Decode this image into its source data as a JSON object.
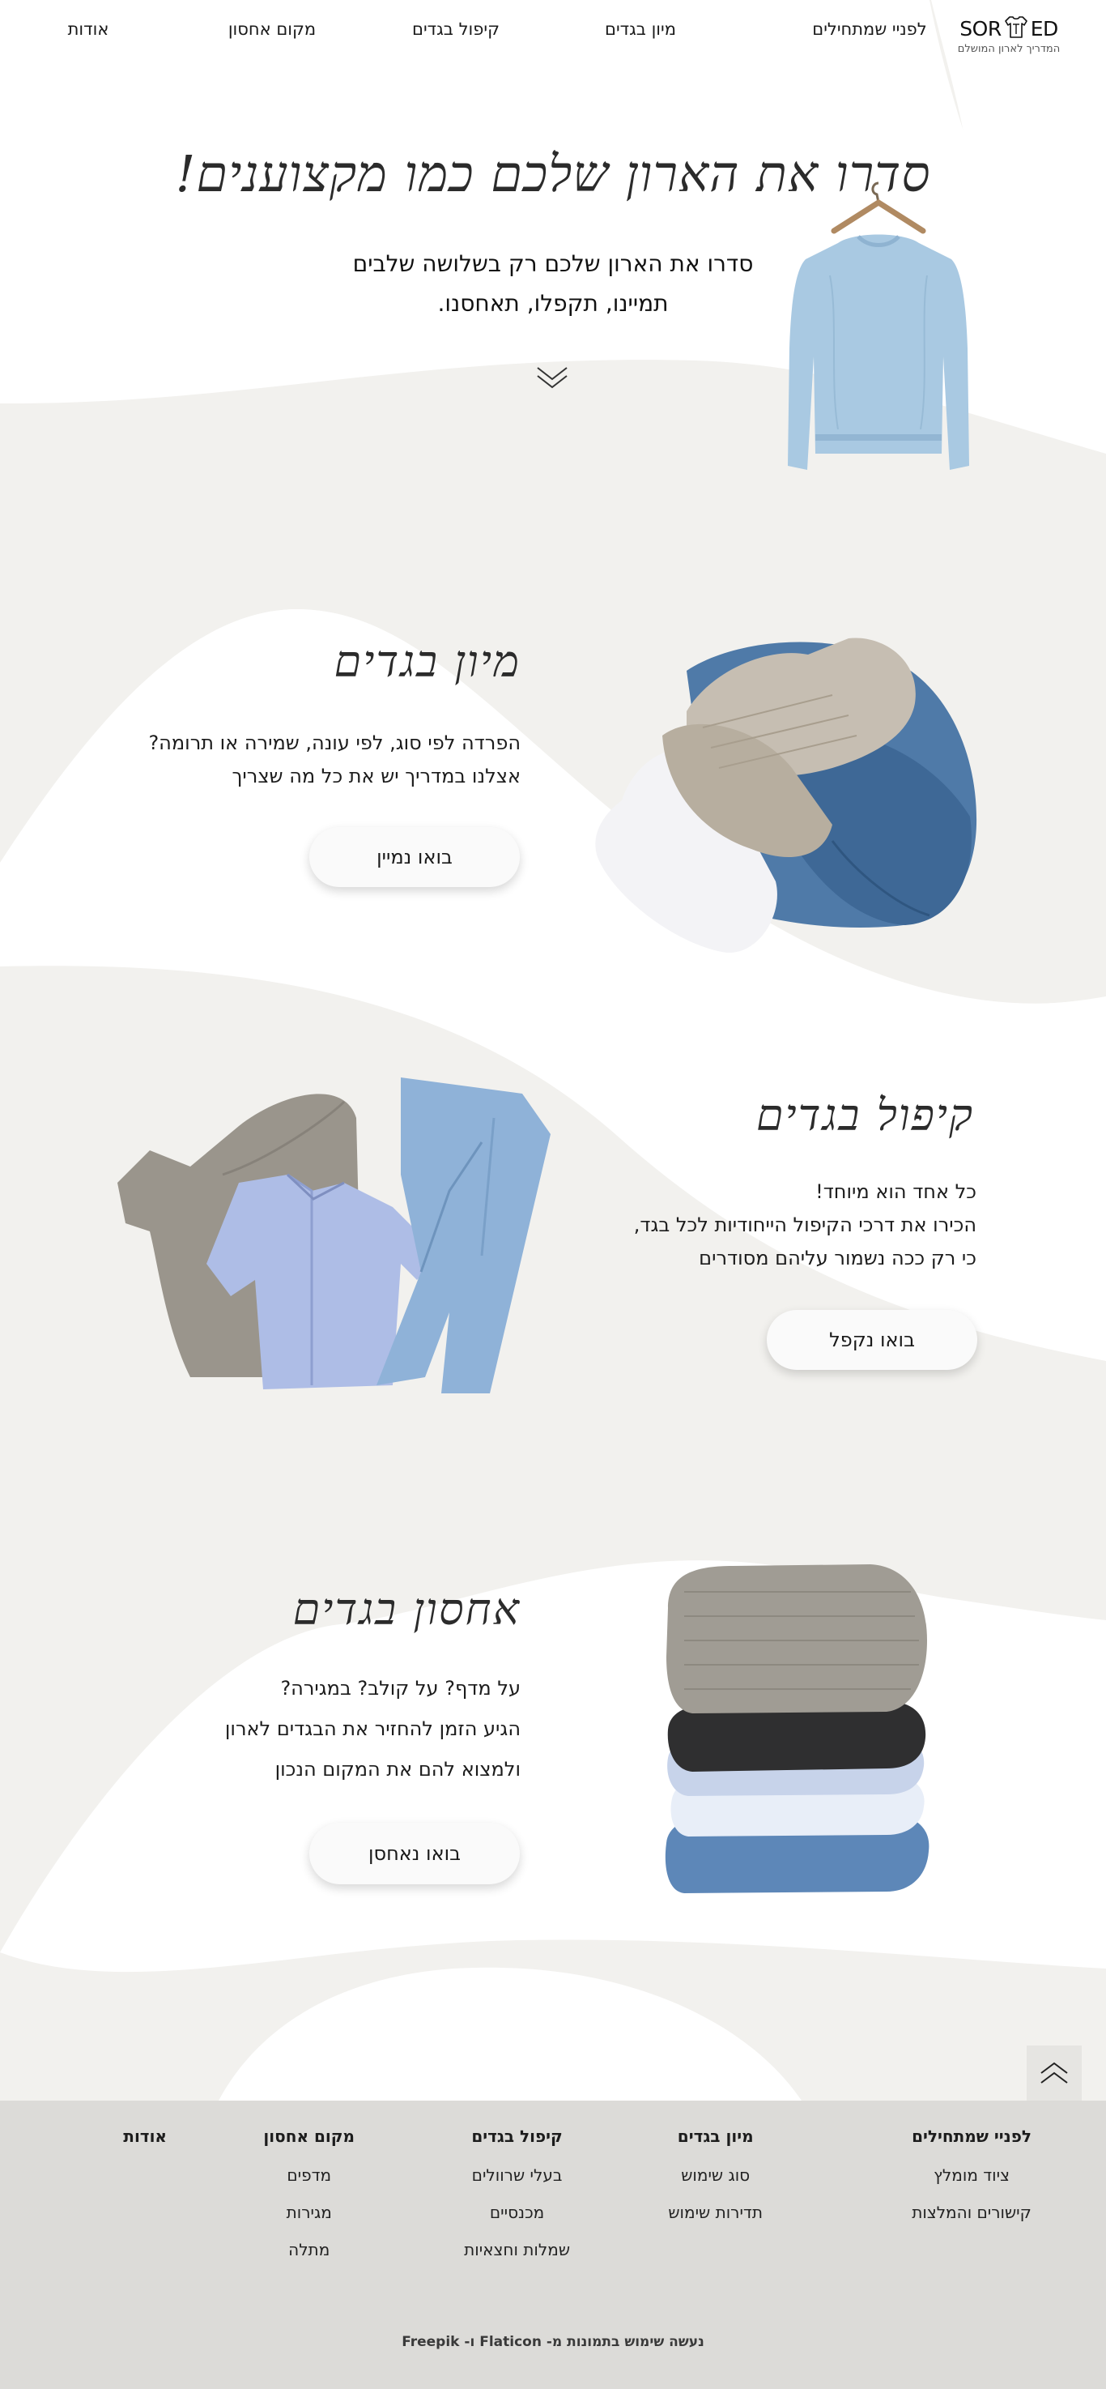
{
  "brand": {
    "logo_text": "SORTED",
    "logo_left": "SOR",
    "logo_right": "ED",
    "tagline": "המדריך לארון המושלם"
  },
  "nav": {
    "items": [
      "לפניי שמתחילים",
      "מיון בגדים",
      "קיפול בגדים",
      "מקום אחסון",
      "אודות"
    ]
  },
  "hero": {
    "title": "סדרו את הארון שלכם כמו מקצוענים!",
    "line1": "סדרו את הארון שלכם רק בשלושה שלבים",
    "line2": "תמיינו, תקפלו, תאחסנו."
  },
  "sorting": {
    "title": "מיון בגדים",
    "lines": [
      "הפרדה לפי סוג, לפי עונה, שמירה או תרומה?",
      "אצלנו במדריך יש את כל מה שצריך"
    ],
    "button": "בואו נמיין"
  },
  "folding": {
    "title": "קיפול בגדים",
    "lines": [
      "כל אחד הוא מיוחד!",
      "הכירו את דרכי הקיפול הייחודיות לכל בגד,",
      "כי רק ככה נשמור עליהם מסודרים"
    ],
    "button": "בואו נקפל"
  },
  "storage": {
    "title": "אחסון בגדים",
    "lines": [
      "על מדף? על קולב? במגירה?",
      "הגיע הזמן להחזיר את הבגדים לארון",
      "ולמצוא להם את המקום הנכון"
    ],
    "button": "בואו נאחסן"
  },
  "footer": {
    "columns": [
      {
        "title": "לפניי שמתחילים",
        "links": [
          "ציוד מומלץ",
          "קישורים והמלצות"
        ]
      },
      {
        "title": "מיון בגדים",
        "links": [
          "סוג שימוש",
          "תדירות שימוש"
        ]
      },
      {
        "title": "קיפול בגדים",
        "links": [
          "בעלי שרוולים",
          "מכנסיים",
          "שמלות וחצאיות"
        ]
      },
      {
        "title": "מקום אחסון",
        "links": [
          "מדפים",
          "מגירות",
          "מתלה"
        ]
      },
      {
        "title": "אודות",
        "links": []
      }
    ],
    "credit": "נעשה שימוש בתמונות מ- Flaticon ו- Freepik"
  },
  "icons": {
    "scroll_down": "chevron-double-down-icon",
    "back_to_top": "chevron-double-up-icon",
    "logo_shirt": "tshirt-icon"
  },
  "colors": {
    "background_blob": "#f2f1ee",
    "footer": "#dcdbd8",
    "button": "#fafafa"
  }
}
